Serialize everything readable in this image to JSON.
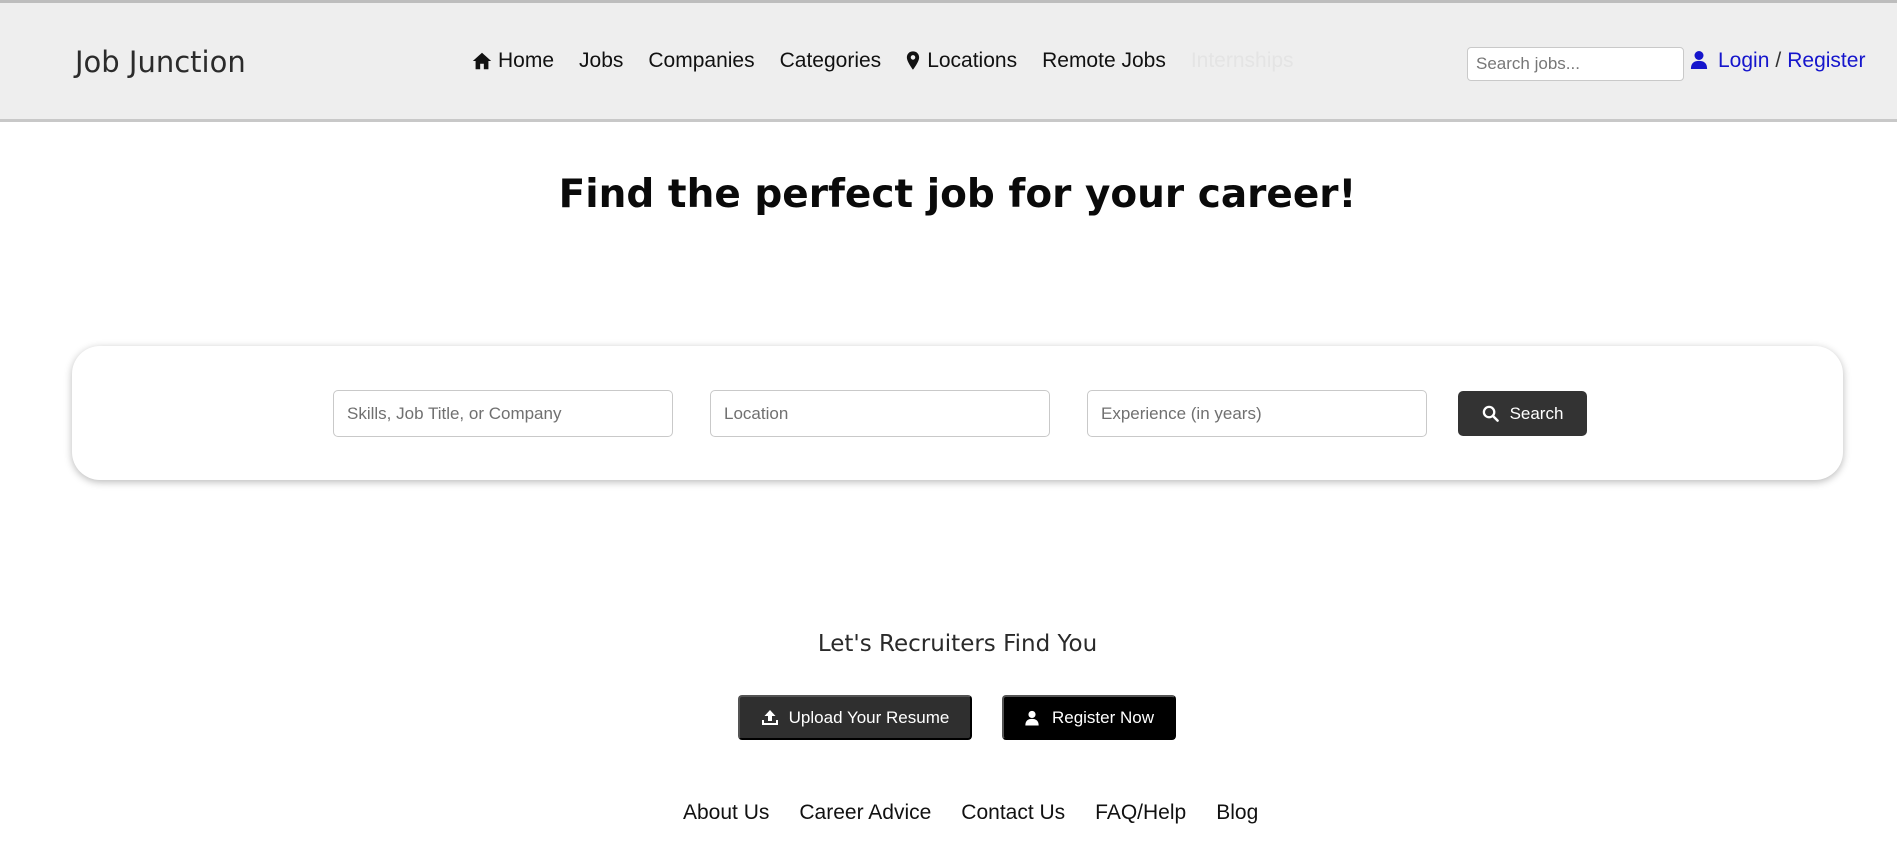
{
  "header": {
    "brand": "Job Junction",
    "nav": [
      {
        "label": "Home",
        "icon": "home-icon"
      },
      {
        "label": "Jobs"
      },
      {
        "label": "Companies"
      },
      {
        "label": "Categories"
      },
      {
        "label": "Locations",
        "icon": "map-pin-icon"
      },
      {
        "label": "Remote Jobs"
      },
      {
        "label": "Internships"
      }
    ],
    "search_placeholder": "Search jobs...",
    "login": "Login",
    "separator": "/",
    "register": "Register",
    "link_color": "#1515cc"
  },
  "hero": {
    "title": "Find the perfect job for your career!",
    "fields": {
      "skills_placeholder": "Skills, Job Title, or Company",
      "location_placeholder": "Location",
      "experience_placeholder": "Experience (in years)"
    },
    "search_label": "Search",
    "search_icon": "search-icon"
  },
  "recruiters": {
    "title": "Let's Recruiters Find You",
    "upload_label": "Upload Your Resume",
    "upload_icon": "upload-icon",
    "register_label": "Register Now",
    "register_icon": "user-icon"
  },
  "footer": {
    "links": [
      "About Us",
      "Career Advice",
      "Contact Us",
      "FAQ/Help",
      "Blog"
    ]
  },
  "colors": {
    "header_bg": "#eeeeee",
    "button_dark": "#333333",
    "button_black": "#000000"
  }
}
